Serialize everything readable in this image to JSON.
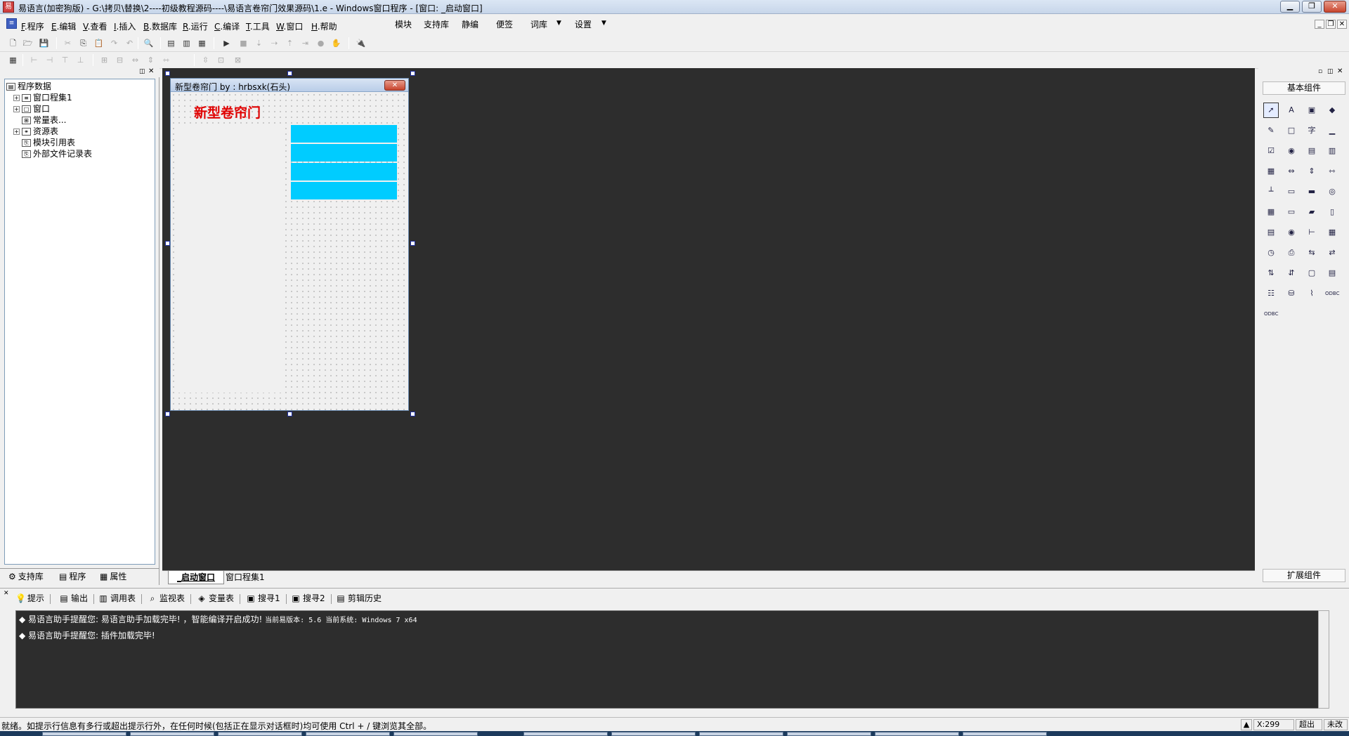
{
  "window": {
    "title": "易语言(加密狗版) - G:\\拷贝\\替换\\2----初级教程源码----\\易语言卷帘门效果源码\\1.e - Windows窗口程序 - [窗口: _启动窗口]",
    "minimize": "▁",
    "restore": "❐",
    "close": "✕"
  },
  "menubar": {
    "items": [
      {
        "key": "F",
        "label": ".程序"
      },
      {
        "key": "E",
        "label": ".编辑"
      },
      {
        "key": "V",
        "label": ".查看"
      },
      {
        "key": "I",
        "label": ".插入"
      },
      {
        "key": "B",
        "label": ".数据库"
      },
      {
        "key": "R",
        "label": ".运行"
      },
      {
        "key": "C",
        "label": ".编译"
      },
      {
        "key": "T",
        "label": ".工具"
      },
      {
        "key": "W",
        "label": ".窗口"
      },
      {
        "key": "H",
        "label": ".帮助"
      }
    ],
    "right_items": [
      "模块",
      "支持库",
      "静编",
      "便签",
      "词库",
      "设置"
    ]
  },
  "toolbar1": {
    "icons": [
      "new-file-icon",
      "open-folder-icon",
      "save-icon",
      "cut-icon",
      "copy-icon",
      "paste-icon",
      "redo-icon",
      "undo-icon",
      "find-icon",
      "layout1-icon",
      "layout2-icon",
      "layout3-icon",
      "run-icon",
      "stop-icon",
      "step-into-icon",
      "step-over-icon",
      "step-out-icon",
      "run-to-cursor-icon",
      "breakpoint-icon",
      "hand-icon",
      "plugin-icon"
    ]
  },
  "toolbar2": {
    "icons": [
      "calc-icon",
      "align-left-icon",
      "align-right-icon",
      "align-top-icon",
      "align-bottom-icon",
      "center-h-icon",
      "center-v-icon",
      "same-width-icon",
      "same-height-icon",
      "space-h-icon",
      "space-v-icon",
      "fit-icon",
      "lock-icon"
    ]
  },
  "leftpanel": {
    "tree": [
      {
        "label": "程序数据",
        "level": 0,
        "expand": ""
      },
      {
        "label": "窗口程集1",
        "level": 1,
        "expand": "+"
      },
      {
        "label": "窗口",
        "level": 1,
        "expand": "+"
      },
      {
        "label": "常量表...",
        "level": 1,
        "expand": ""
      },
      {
        "label": "资源表",
        "level": 1,
        "expand": "+"
      },
      {
        "label": "模块引用表",
        "level": 1,
        "expand": ""
      },
      {
        "label": "外部文件记录表",
        "level": 1,
        "expand": ""
      }
    ],
    "tabs": [
      "支持库",
      "程序",
      "属性"
    ]
  },
  "form": {
    "title": "新型卷帘门 by : hrbsxk(石头)",
    "heading": "新型卷帘门",
    "close": "✕",
    "bars": 4
  },
  "doctabs": [
    "_启动窗口",
    "窗口程集1"
  ],
  "rightpanel": {
    "basic_title": "基本组件",
    "ext_title": "扩展组件",
    "components": [
      "pointer-icon",
      "label-icon",
      "picture-icon",
      "shape-icon",
      "edit-icon",
      "editbox-icon",
      "text-icon",
      "line-icon",
      "checkbox-icon",
      "radio-icon",
      "listbox-icon",
      "combobox-icon",
      "grid-icon",
      "scrollbar-icon",
      "vscroll-icon",
      "hscroll-icon",
      "ruler-icon",
      "frame-icon",
      "progress-icon",
      "camera-icon",
      "calendar-icon",
      "button-icon",
      "folder-icon",
      "file-icon",
      "table-icon",
      "cd-icon",
      "slider-icon",
      "panel-icon",
      "timer-icon",
      "printer-icon",
      "net-icon",
      "net2-icon",
      "client-icon",
      "server-icon",
      "window-icon",
      "tabs-icon",
      "db-list-icon",
      "db-icon",
      "chart-icon",
      "odbc-icon",
      "odbc2-icon"
    ],
    "component_glyphs": [
      "➚",
      "A",
      "▣",
      "◆",
      "✎",
      "□",
      "字",
      "▁",
      "☑",
      "◉",
      "▤",
      "▥",
      "▦",
      "⇔",
      "⇕",
      "⇿",
      "┴",
      "▭",
      "▬",
      "◎",
      "▦",
      "▭",
      "▰",
      "▯",
      "▤",
      "◉",
      "⊢",
      "▦",
      "◷",
      "⎙",
      "⇆",
      "⇄",
      "⇅",
      "⇵",
      "▢",
      "▤",
      "☷",
      "⛁",
      "⌇",
      "ODBC",
      "ODBC"
    ]
  },
  "output": {
    "tabs": [
      {
        "icon": "hint-icon",
        "glyph": "💡",
        "label": "提示"
      },
      {
        "icon": "output-icon",
        "glyph": "▤",
        "label": "输出"
      },
      {
        "icon": "calltable-icon",
        "glyph": "▥",
        "label": "调用表"
      },
      {
        "icon": "watch-icon",
        "glyph": "⌕",
        "label": "监视表"
      },
      {
        "icon": "vars-icon",
        "glyph": "◈",
        "label": "变量表"
      },
      {
        "icon": "search1-icon",
        "glyph": "▣",
        "label": "搜寻1"
      },
      {
        "icon": "search2-icon",
        "glyph": "▣",
        "label": "搜寻2"
      },
      {
        "icon": "cliphistory-icon",
        "glyph": "▤",
        "label": "剪辑历史"
      }
    ],
    "lines": [
      {
        "prefix": "◆ 易语言助手提醒您: 易语言助手加载完毕! ，智能编译开启成功! ",
        "mono": "当前易版本: 5.6  当前系统: Windows 7 x64"
      },
      {
        "prefix": "◆ 易语言助手提醒您: 插件加载完毕!",
        "mono": ""
      }
    ]
  },
  "status": {
    "text": "就绪。如提示行信息有多行或超出提示行外，在任何时候(包括正在显示对话框时)均可使用 Ctrl + / 键浏览其全部。",
    "coord": "X:299",
    "overwrite": "超出",
    "saved": "未改"
  }
}
